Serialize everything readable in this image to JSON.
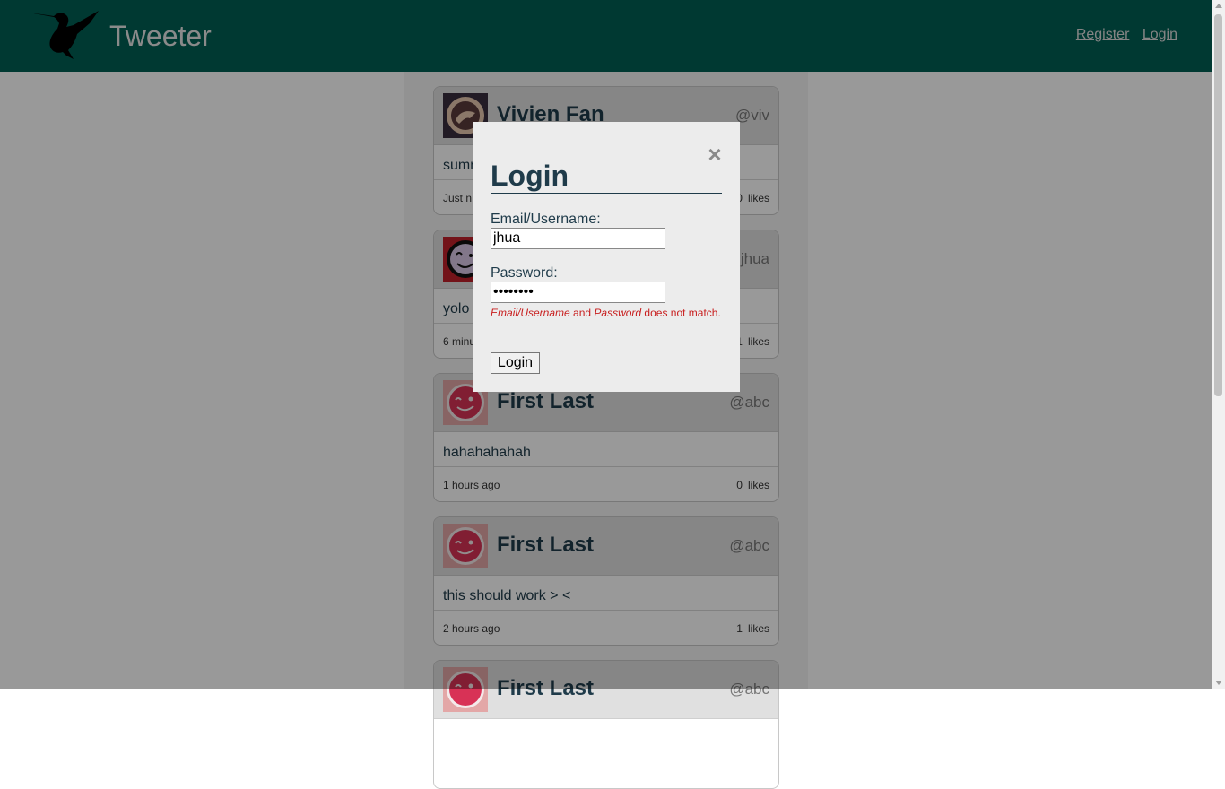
{
  "header": {
    "brand": "Tweeter",
    "nav": {
      "register": "Register",
      "login": "Login"
    }
  },
  "feed": [
    {
      "name": "Vivien Fan",
      "handle": "@viv",
      "content": "summ",
      "time": "Just n",
      "likes": "0",
      "likes_label": "likes"
    },
    {
      "name": "",
      "handle": "jhua",
      "content": "yolo",
      "time": "6 minu",
      "likes": "1",
      "likes_label": "likes"
    },
    {
      "name": "First Last",
      "handle": "@abc",
      "content": "hahahahahah",
      "time": "1 hours ago",
      "likes": "0",
      "likes_label": "likes"
    },
    {
      "name": "First Last",
      "handle": "@abc",
      "content": "this should work > <",
      "time": "2 hours ago",
      "likes": "1",
      "likes_label": "likes"
    },
    {
      "name": "First Last",
      "handle": "@abc",
      "content": "",
      "time": "",
      "likes": "",
      "likes_label": ""
    }
  ],
  "modal": {
    "close": "×",
    "title": "Login",
    "email_label": "Email/Username:",
    "email_value": "jhua",
    "password_label": "Password:",
    "password_value": "••••••••",
    "error": {
      "field1": "Email/Username",
      "and": " and ",
      "field2": "Password",
      "tail": " does not match."
    },
    "submit": "Login"
  },
  "colors": {
    "header_bg": "#005f54",
    "error": "#c81e1e",
    "title": "#1f3b4a"
  },
  "icons": {
    "logo": "hummingbird-icon",
    "close": "close-icon"
  }
}
